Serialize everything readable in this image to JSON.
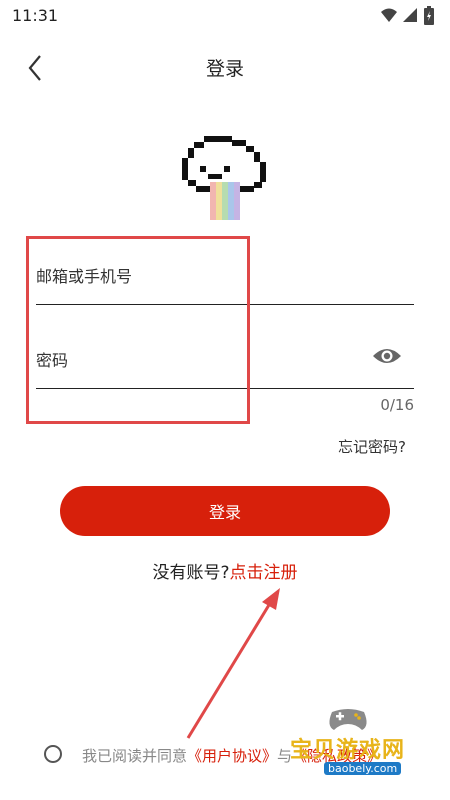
{
  "status": {
    "time": "11:31"
  },
  "header": {
    "title": "登录"
  },
  "form": {
    "email_placeholder": "邮箱或手机号",
    "password_placeholder": "密码",
    "counter": "0/16",
    "forgot": "忘记密码?"
  },
  "login_button": "登录",
  "register": {
    "prompt": "没有账号?",
    "link": "点击注册"
  },
  "agreement": {
    "prefix": "我已阅读并同意",
    "user_agreement": "《用户协议》",
    "conjunction": "与",
    "privacy_policy": "《隐私政策》"
  },
  "watermark": {
    "title": "宝贝游戏网",
    "url": "baobely.com"
  },
  "colors": {
    "accent": "#d7200b",
    "annotation": "#e04848"
  }
}
